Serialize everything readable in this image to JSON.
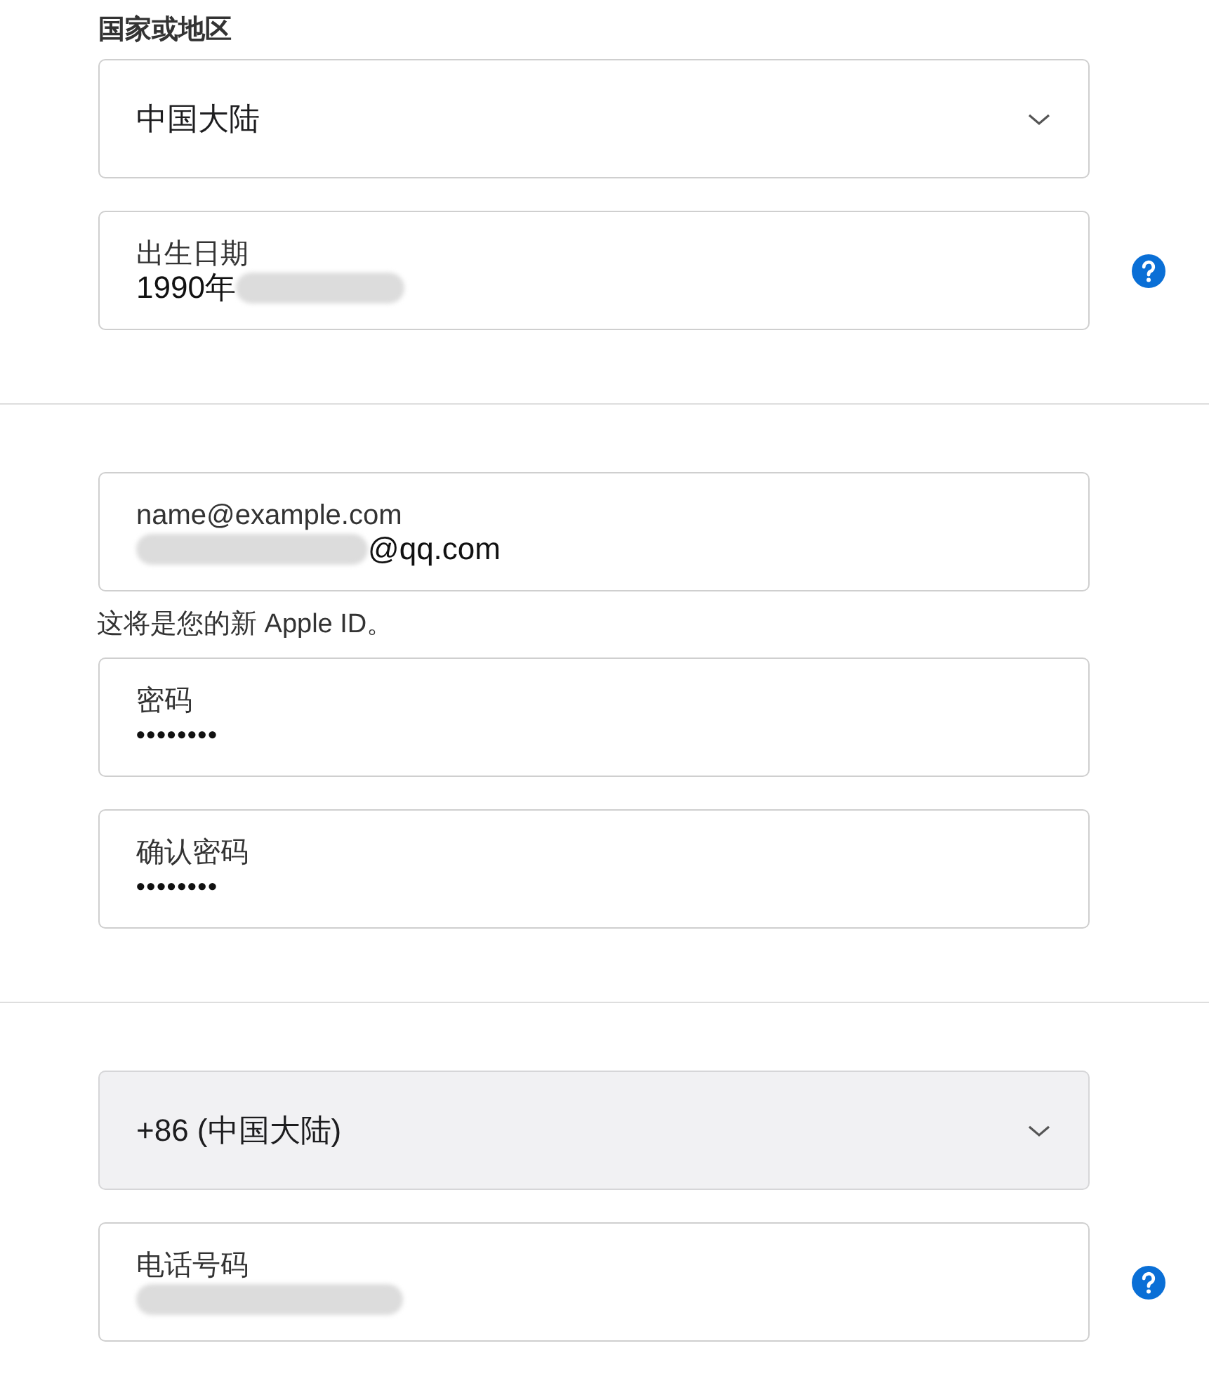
{
  "country_label": "国家或地区",
  "sections": [
    {
      "items": [
        {
          "kind": "select",
          "value": "中国大陆",
          "disabled": false
        },
        {
          "kind": "field",
          "label": "出生日期",
          "value": "1990年",
          "blur_after": true,
          "help": true
        }
      ]
    },
    {
      "items": [
        {
          "kind": "field",
          "label": "name@example.com",
          "value": "@qq.com",
          "blur_before": true
        },
        {
          "kind": "note",
          "text": "这将是您的新 Apple ID。"
        },
        {
          "kind": "field",
          "label": "密码",
          "value": "••••••••",
          "masked": true
        },
        {
          "kind": "field",
          "label": "确认密码",
          "value": "••••••••",
          "masked": true
        }
      ]
    },
    {
      "items": [
        {
          "kind": "select",
          "value": "+86 (中国大陆)",
          "disabled": true
        },
        {
          "kind": "field",
          "label": "电话号码",
          "blur_before": true,
          "help": true
        }
      ]
    }
  ]
}
